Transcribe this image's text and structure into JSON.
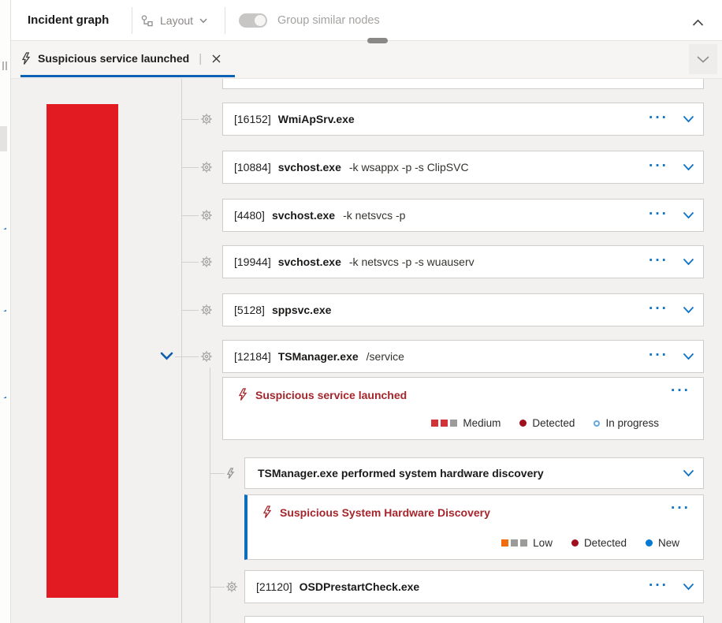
{
  "toolbar": {
    "title": "Incident graph",
    "layout_label": "Layout",
    "group_toggle_label": "Group similar nodes",
    "group_toggle_state": "on-disabled"
  },
  "tab": {
    "label": "Suspicious service launched"
  },
  "icons": {
    "more": "···"
  },
  "graph": {
    "nodes": [
      {
        "pid": "[16152]",
        "name": "WmiApSrv.exe",
        "args": ""
      },
      {
        "pid": "[10884]",
        "name": "svchost.exe",
        "args": "-k wsappx -p -s ClipSVC"
      },
      {
        "pid": "[4480]",
        "name": "svchost.exe",
        "args": "-k netsvcs -p"
      },
      {
        "pid": "[19944]",
        "name": "svchost.exe",
        "args": "-k netsvcs -p -s wuauserv"
      },
      {
        "pid": "[5128]",
        "name": "sppsvc.exe",
        "args": ""
      },
      {
        "pid": "[12184]",
        "name": "TSManager.exe",
        "args": "/service"
      }
    ],
    "alert_service": {
      "title": "Suspicious service launched",
      "severity": "Medium",
      "detection_source": "Detected",
      "status": "In progress"
    },
    "behavior_node": {
      "title": "TSManager.exe performed system hardware discovery"
    },
    "alert_discovery": {
      "title": "Suspicious System Hardware Discovery",
      "severity": "Low",
      "detection_source": "Detected",
      "status": "New"
    },
    "child_node": {
      "pid": "[21120]",
      "name": "OSDPrestartCheck.exe",
      "args": ""
    }
  },
  "colors": {
    "accent_blue": "#1173c5",
    "tab_underline": "#0c62b5",
    "alert_red": "#a4262c",
    "severity_medium_squares": [
      "#d13438",
      "#d13438",
      "#9d9b99"
    ],
    "severity_low_squares": [
      "#f26b0c",
      "#9d9b99",
      "#9d9b99"
    ],
    "detected_dot": "#a00f1e",
    "new_dot": "#0078d4",
    "in_progress_ring": "#66a8e0",
    "red_node_block": "#e21b23",
    "graph_background": "#f2f1f0"
  }
}
